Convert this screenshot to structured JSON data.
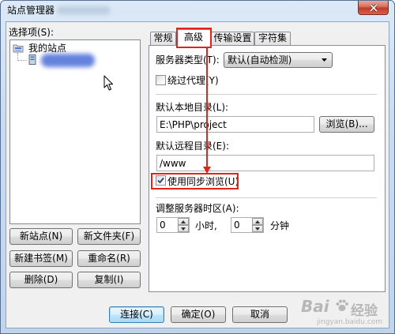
{
  "window": {
    "title": "站点管理器"
  },
  "left_panel": {
    "select_label": "选择项(S):",
    "tree": {
      "root_label": "我的站点"
    },
    "buttons": {
      "new_site": "新站点(N)",
      "new_folder": "新文件夹(F)",
      "new_bookmark": "新建书签(M)",
      "rename": "重命名(R)",
      "delete": "删除(D)",
      "copy": "复制(I)"
    }
  },
  "tabs": [
    {
      "label": "常规",
      "selected": false
    },
    {
      "label": "高级",
      "selected": true
    },
    {
      "label": "传输设置",
      "selected": false
    },
    {
      "label": "字符集",
      "selected": false
    }
  ],
  "advanced": {
    "server_type_label": "服务器类型(T):",
    "server_type_value": "默认(自动检测)",
    "bypass_proxy_label": "绕过代理(Y)",
    "bypass_proxy_checked": false,
    "local_dir_label": "默认本地目录(L):",
    "local_dir_value": "E:\\PHP\\project",
    "browse_label": "浏览(B)...",
    "remote_dir_label": "默认远程目录(E):",
    "remote_dir_value": "/www",
    "sync_browse_label": "使用同步浏览(U)",
    "sync_browse_checked": true,
    "timezone_label": "调整服务器时区(A):",
    "hours_value": "0",
    "hours_label": "小时,",
    "minutes_value": "0",
    "minutes_label": "分钟"
  },
  "footer": {
    "connect": "连接(C)",
    "ok": "确定(O)",
    "cancel": "取消"
  },
  "watermark": {
    "brand": "Bai",
    "brand_cn": "经验",
    "url": "jingyan.baidu.com"
  },
  "icons": {
    "close": "close-icon",
    "tree_root": "site-folder-icon",
    "tree_site": "server-icon",
    "dropdown": "chevron-down-icon",
    "checkbox_check": "checkmark-icon",
    "spin_up": "triangle-up-icon",
    "spin_down": "triangle-down-icon",
    "cursor": "mouse-cursor-icon",
    "watermark_logo": "paw-icon"
  },
  "colors": {
    "annotation": "#e0241a",
    "close_button": "#c13a2a",
    "default_button_border": "#3c7fb1"
  }
}
